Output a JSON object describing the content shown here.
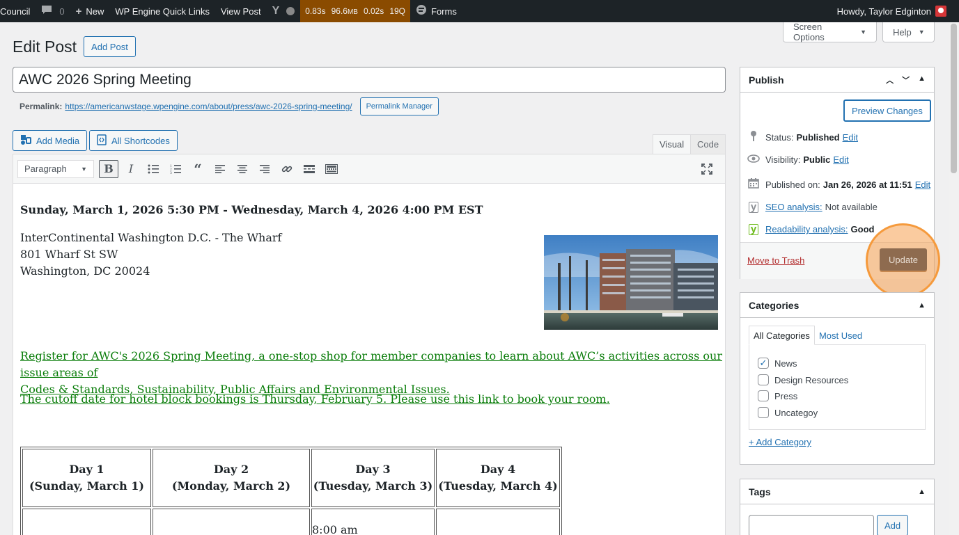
{
  "adminbar": {
    "site_name": "Council",
    "comments_count": "0",
    "new_label": "New",
    "quick_links": "WP Engine Quick Links",
    "view_post": "View Post",
    "perf": {
      "time": "0.83s",
      "memory": "96.6",
      "memory_unit": "MB",
      "db_time": "0.02s",
      "queries": "19Q"
    },
    "forms": "Forms",
    "howdy": "Howdy, Taylor Edginton"
  },
  "screen_options": {
    "screen_options_label": "Screen Options",
    "help_label": "Help"
  },
  "page": {
    "title": "Edit Post",
    "add_post_label": "Add Post"
  },
  "post": {
    "title": "AWC 2026 Spring Meeting",
    "permalink_label": "Permalink:",
    "permalink_url": "https://americanwstage.wpengine.com/about/press/awc-2026-spring-meeting/",
    "permalink_manager_label": "Permalink Manager"
  },
  "media_buttons": {
    "add_media": "Add Media",
    "all_shortcodes": "All Shortcodes"
  },
  "editor_tabs": {
    "visual": "Visual",
    "code": "Code"
  },
  "toolbar": {
    "format_select": "Paragraph"
  },
  "content": {
    "date_line": "Sunday, March 1, 2026 5:30 PM - Wednesday, March 4, 2026 4:00 PM EST",
    "address": [
      "InterContinental Washington D.C. - The Wharf",
      "801 Wharf St SW",
      "Washington, DC 20024"
    ],
    "register_link_line1": "Register for AWC's 2026 Spring Meeting, a one-stop shop for member companies to learn about AWC’s activities across our issue areas of",
    "register_link_line2": "Codes & Standards, Sustainability, Public Affairs and Environmental Issues.",
    "cutoff_link": "The cutoff date for hotel block bookings is Thursday, February 5. Please use this link to book your room.",
    "schedule": {
      "headers": [
        {
          "day": "Day 1",
          "date": "(Sunday, March 1)"
        },
        {
          "day": "Day 2",
          "date": "(Monday, March 2)"
        },
        {
          "day": "Day 3",
          "date": "(Tuesday, March 3)"
        },
        {
          "day": "Day 4",
          "date": "(Tuesday, March 4)"
        }
      ],
      "row2": [
        "",
        "",
        "8:00 am",
        ""
      ]
    }
  },
  "publish": {
    "title": "Publish",
    "preview_label": "Preview Changes",
    "status_label": "Status:",
    "status_value": "Published",
    "status_edit": "Edit",
    "visibility_label": "Visibility:",
    "visibility_value": "Public",
    "visibility_edit": "Edit",
    "published_label": "Published on:",
    "published_value": "Jan 26, 2026 at 11:51",
    "published_edit": "Edit",
    "seo_link": "SEO analysis:",
    "seo_value": "Not available",
    "readability_link": "Readability analysis:",
    "readability_value": "Good",
    "trash_label": "Move to Trash",
    "update_label": "Update"
  },
  "categories": {
    "title": "Categories",
    "tab_all": "All Categories",
    "tab_most_used": "Most Used",
    "items": [
      {
        "label": "News",
        "checked": true
      },
      {
        "label": "Design Resources",
        "checked": false
      },
      {
        "label": "Press",
        "checked": false
      },
      {
        "label": "Uncategoy",
        "checked": false
      }
    ],
    "add_label": "+ Add Category"
  },
  "tags": {
    "title": "Tags",
    "add_label": "Add"
  },
  "colors": {
    "link": "#2271b1",
    "green_link": "#0a7d0a",
    "highlight": "#f59a3c",
    "adminbar": "#1d2327"
  }
}
